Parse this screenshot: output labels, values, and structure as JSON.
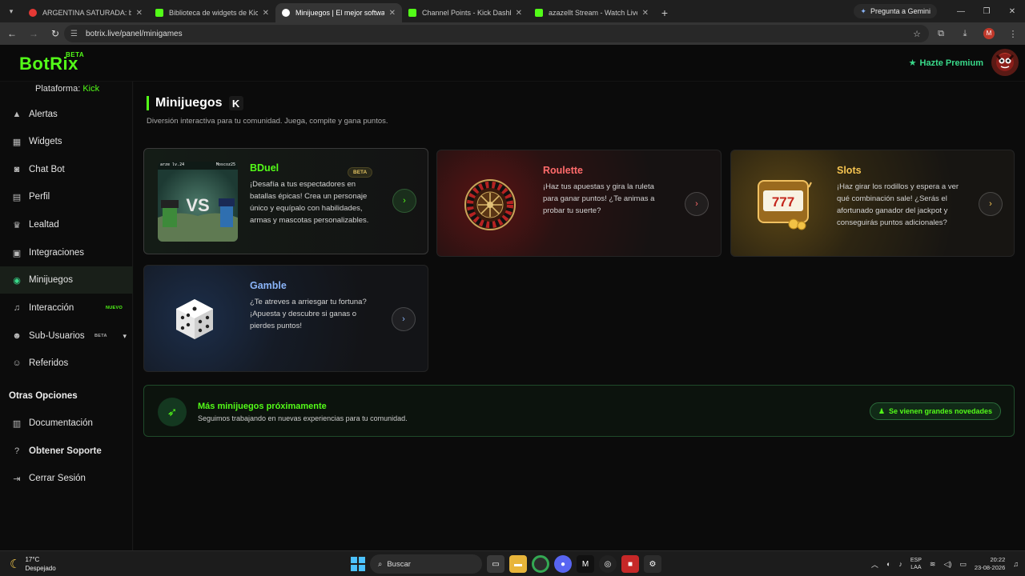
{
  "browser": {
    "tabs": [
      {
        "title": "ARGENTINA SATURADA: botón",
        "color": "#e53935"
      },
      {
        "title": "Biblioteca de widgets de KickBot",
        "color": "#53fc18"
      },
      {
        "title": "Minijuegos | El mejor software",
        "color": "#ffffff"
      },
      {
        "title": "Channel Points - Kick Dashboard",
        "color": "#53fc18"
      },
      {
        "title": "azazellt Stream - Watch Live o",
        "color": "#53fc18"
      }
    ],
    "gemini_label": "Pregunta a Gemini",
    "url": "botrix.live/panel/minigames",
    "profile_initial": "M"
  },
  "app": {
    "logo": "BotRix",
    "logo_badge": "BETA",
    "premium_label": "Hazte Premium",
    "platform_label": "Plataforma:",
    "platform_value": "Kick"
  },
  "sidebar": {
    "items": [
      {
        "label": "Alertas",
        "icon": "warning-icon"
      },
      {
        "label": "Widgets",
        "icon": "grid-icon"
      },
      {
        "label": "Chat Bot",
        "icon": "robot-icon"
      },
      {
        "label": "Perfil",
        "icon": "id-card-icon"
      },
      {
        "label": "Lealtad",
        "icon": "trophy-icon"
      },
      {
        "label": "Integraciones",
        "icon": "plug-icon"
      },
      {
        "label": "Minijuegos",
        "icon": "gamepad-icon"
      },
      {
        "label": "Interacción",
        "icon": "music-icon",
        "tag": "NUEVO"
      },
      {
        "label": "Sub-Usuarios",
        "icon": "users-icon",
        "tag": "BETA"
      },
      {
        "label": "Referidos",
        "icon": "referral-icon"
      }
    ],
    "section_title": "Otras Opciones",
    "other_items": [
      {
        "label": "Documentación",
        "icon": "document-icon"
      },
      {
        "label": "Obtener Soporte",
        "icon": "help-icon"
      },
      {
        "label": "Cerrar Sesión",
        "icon": "logout-icon"
      }
    ]
  },
  "page": {
    "title": "Minijuegos",
    "subtitle": "Diversión interactiva para tu comunidad. Juega, compite y gana puntos."
  },
  "games": [
    {
      "name": "BDuel",
      "badge": "BETA",
      "color": "#53fc18",
      "description": "¡Desafía a tus espectadores en batallas épicas! Crea un personaje único y equípalo con habilidades, armas y mascotas personalizables."
    },
    {
      "name": "Roulette",
      "color": "#ff6b6b",
      "description": "¡Haz tus apuestas y gira la ruleta para ganar puntos! ¿Te animas a probar tu suerte?"
    },
    {
      "name": "Slots",
      "color": "#f5c451",
      "description": "¡Haz girar los rodillos y espera a ver qué combinación sale! ¿Serás el afortunado ganador del jackpot y conseguirás puntos adicionales?"
    },
    {
      "name": "Gamble",
      "color": "#8ab4f8",
      "description": "¿Te atreves a arriesgar tu fortuna? ¡Apuesta y descubre si ganas o pierdes puntos!"
    }
  ],
  "bduel_image": {
    "left_label": "arze  lv.24",
    "right_label": "Moscoz25",
    "vs": "VS"
  },
  "slots_image": {
    "reels": "777"
  },
  "banner": {
    "title": "Más minijuegos próximamente",
    "subtitle": "Seguimos trabajando en nuevas experiencias para tu comunidad.",
    "button": "Se vienen grandes novedades"
  },
  "taskbar": {
    "temperature": "17°C",
    "weather": "Despejado",
    "search": "Buscar",
    "lang1": "ESP",
    "lang2": "LAA",
    "time": "20:22",
    "date": "23-08-2026"
  }
}
